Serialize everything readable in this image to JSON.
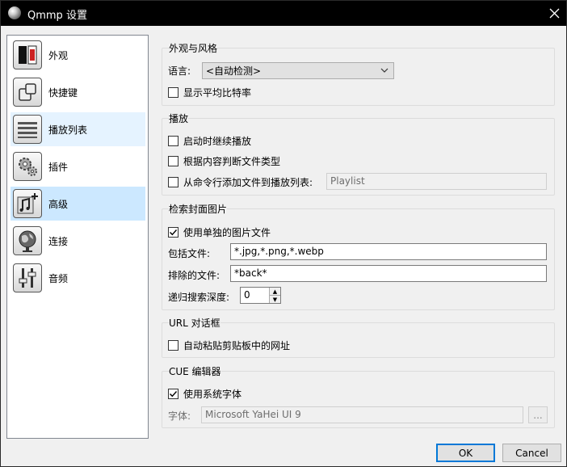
{
  "window": {
    "title": "Qmmp 设置"
  },
  "nav": {
    "items": [
      {
        "label": "外观",
        "icon": "appearance-icon"
      },
      {
        "label": "快捷键",
        "icon": "shortcuts-icon"
      },
      {
        "label": "播放列表",
        "icon": "playlist-icon"
      },
      {
        "label": "插件",
        "icon": "plugins-icon"
      },
      {
        "label": "高级",
        "icon": "advanced-icon"
      },
      {
        "label": "连接",
        "icon": "connectivity-icon"
      },
      {
        "label": "音频",
        "icon": "audio-icon"
      }
    ],
    "selected": "高级",
    "hovered": "播放列表"
  },
  "look": {
    "title": "外观与风格",
    "language_label": "语言:",
    "language_value": "<自动检测>",
    "show_bitrate_label": "显示平均比特率",
    "show_bitrate_checked": false
  },
  "playback": {
    "title": "播放",
    "resume_label": "启动时继续播放",
    "resume_checked": false,
    "detect_type_label": "根据内容判断文件类型",
    "detect_type_checked": false,
    "add_from_cmd_label": "从命令行添加文件到播放列表:",
    "add_from_cmd_checked": false,
    "playlist_value": "Playlist"
  },
  "cover": {
    "title": "检索封面图片",
    "use_separate_label": "使用单独的图片文件",
    "use_separate_checked": true,
    "include_label": "包括文件:",
    "include_value": "*.jpg,*.png,*.webp",
    "exclude_label": "排除的文件:",
    "exclude_value": "*back*",
    "depth_label": "递归搜索深度:",
    "depth_value": "0"
  },
  "url": {
    "title": "URL 对话框",
    "auto_paste_label": "自动粘贴剪贴板中的网址",
    "auto_paste_checked": false
  },
  "cue": {
    "title": "CUE 编辑器",
    "system_font_label": "使用系统字体",
    "system_font_checked": true,
    "font_label": "字体:",
    "font_value": "Microsoft YaHei UI 9",
    "browse_label": "..."
  },
  "buttons": {
    "ok": "OK",
    "cancel": "Cancel"
  }
}
